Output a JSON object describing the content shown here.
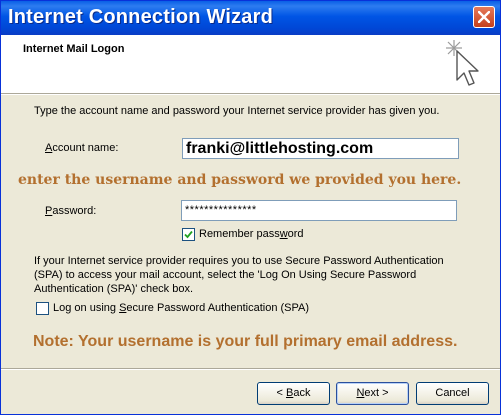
{
  "window": {
    "title": "Internet Connection Wizard"
  },
  "header": {
    "title": "Internet Mail Logon"
  },
  "intro": "Type the account name and password your Internet service provider has given you.",
  "account": {
    "label_u": "A",
    "label_rest": "ccount name:",
    "value": "franki@littlehosting.com"
  },
  "annotation_top": "enter the username and password we provided you  here.",
  "password": {
    "label_u": "P",
    "label_rest": "assword:",
    "value": "***************"
  },
  "remember": {
    "label_pre": "Remember pass",
    "label_u": "w",
    "label_post": "ord",
    "checked": true
  },
  "spa": {
    "info": "If your Internet service provider requires you to use Secure Password Authentication (SPA) to access your mail account, select the 'Log On Using Secure Password Authentication (SPA)' check box.",
    "label_pre": "Log on using ",
    "label_u": "S",
    "label_post": "ecure Password Authentication (SPA)",
    "checked": false
  },
  "annotation_bottom": "Note: Your username is your full primary email address.",
  "buttons": {
    "back_pre": "< ",
    "back_u": "B",
    "back_post": "ack",
    "next_u": "N",
    "next_post": "ext >",
    "cancel": "Cancel"
  },
  "icons": {
    "close": "close-icon",
    "wizard": "wizard-sparkle-cursor-icon",
    "check": "checkmark-icon"
  }
}
